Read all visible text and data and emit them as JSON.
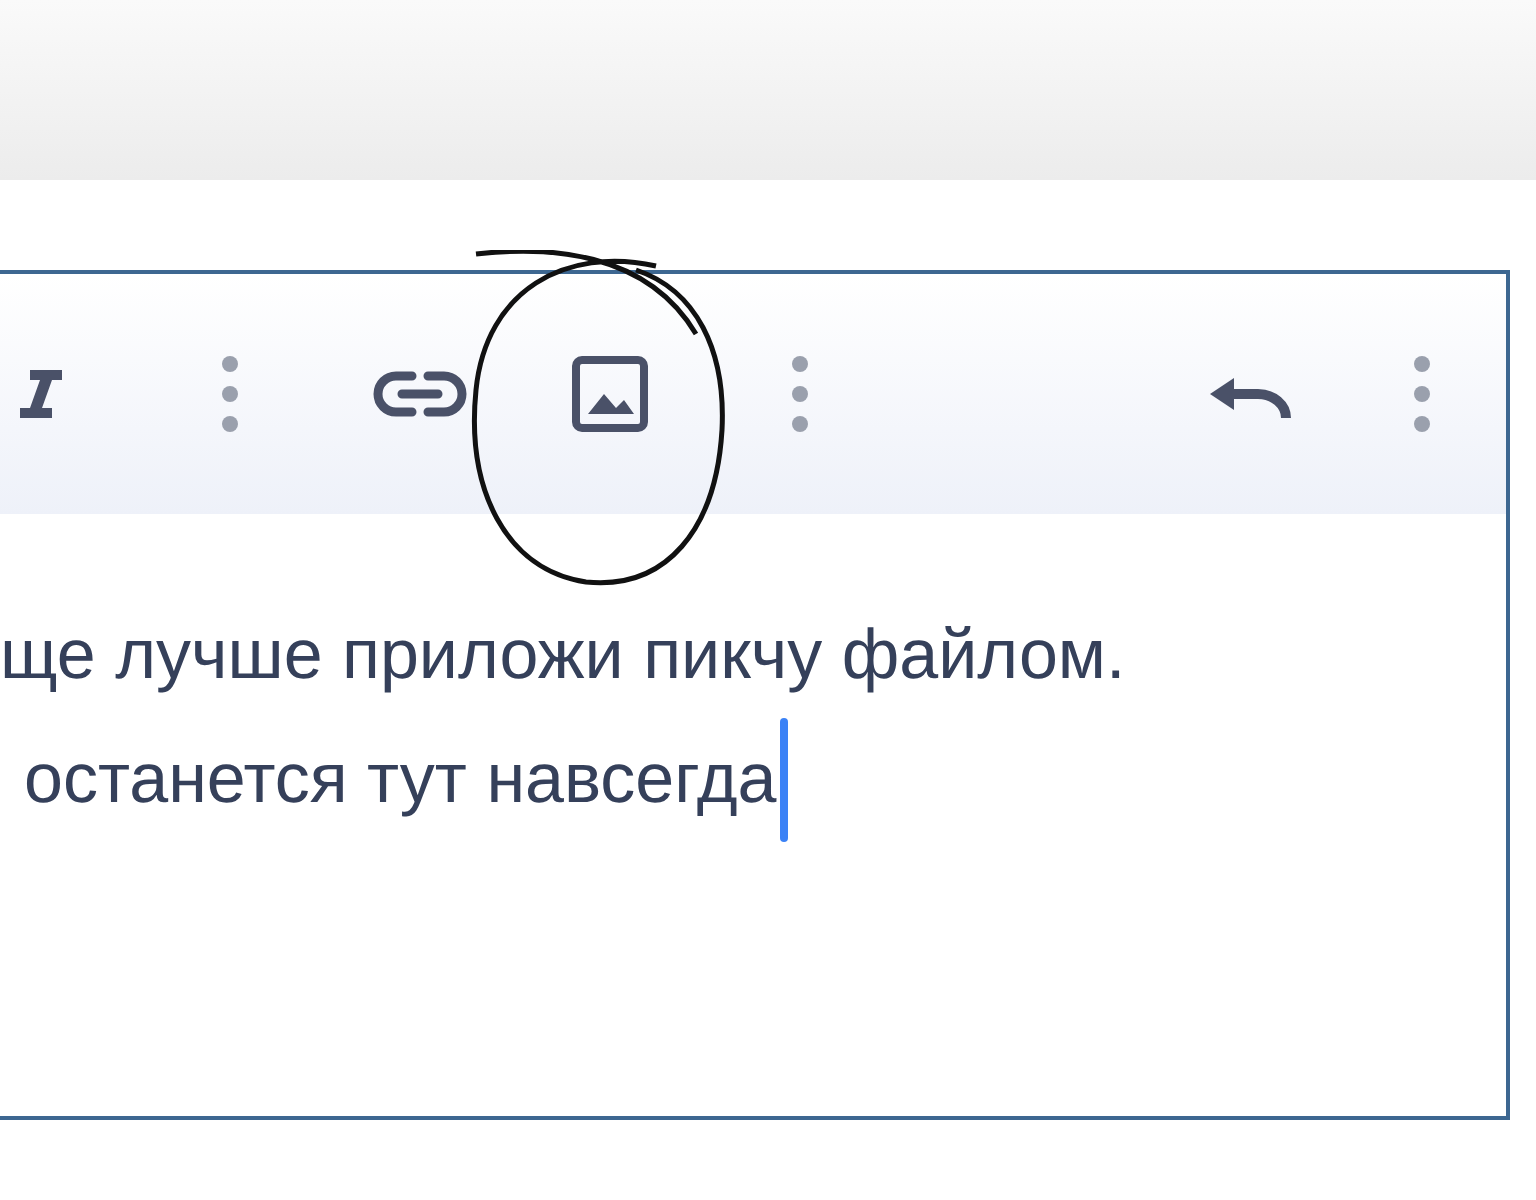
{
  "toolbar": {
    "left": [
      {
        "kind": "italic"
      },
      {
        "kind": "more"
      },
      {
        "kind": "link"
      },
      {
        "kind": "image"
      },
      {
        "kind": "more"
      }
    ],
    "right": [
      {
        "kind": "undo"
      },
      {
        "kind": "more"
      }
    ]
  },
  "annotation": {
    "kind": "circle"
  },
  "editor": {
    "lines": [
      "ще лучше приложи пикчу файлом.",
      "останется тут навсегда"
    ],
    "cursor": true
  }
}
